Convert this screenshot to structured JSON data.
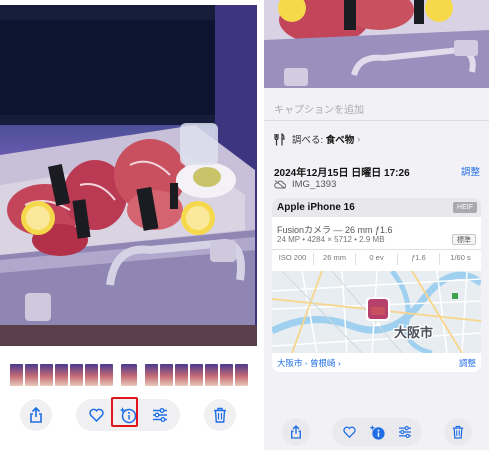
{
  "right_panel": {
    "caption_placeholder": "キャプションを追加",
    "lookup": {
      "prefix": "調べる: ",
      "subject": "食べ物",
      "chevron": "›"
    },
    "datetime": "2024年12月15日 日曜日 17:26",
    "adjust_label": "調整",
    "filename": "IMG_1393",
    "camera": {
      "device": "Apple iPhone 16",
      "format_badge": "HEIF",
      "lens": "Fusionカメラ — 26 mm ƒ1.6",
      "specs": "24 MP • 4284 × 5712 • 2.9 MB",
      "standard_badge": "標準",
      "exif": [
        "ISO 200",
        "26 mm",
        "0 ev",
        "ƒ1.6",
        "1/60 s"
      ]
    },
    "map": {
      "city_label": "大阪市",
      "location": "大阪市 - 曾根崎",
      "location_chevron": "›",
      "adjust_label": "調整"
    }
  },
  "colors": {
    "accent": "#1f6ee6",
    "highlight": "#e0161b",
    "toolbar_bg": "#f0f0f2"
  },
  "icons": {
    "left_toolbar": [
      "share-icon",
      "heart-icon",
      "info-sparkle-icon",
      "adjust-sliders-icon",
      "trash-icon"
    ],
    "right_toolbar": [
      "share-icon",
      "heart-icon",
      "info-sparkle-icon",
      "adjust-sliders-icon",
      "trash-icon"
    ]
  }
}
